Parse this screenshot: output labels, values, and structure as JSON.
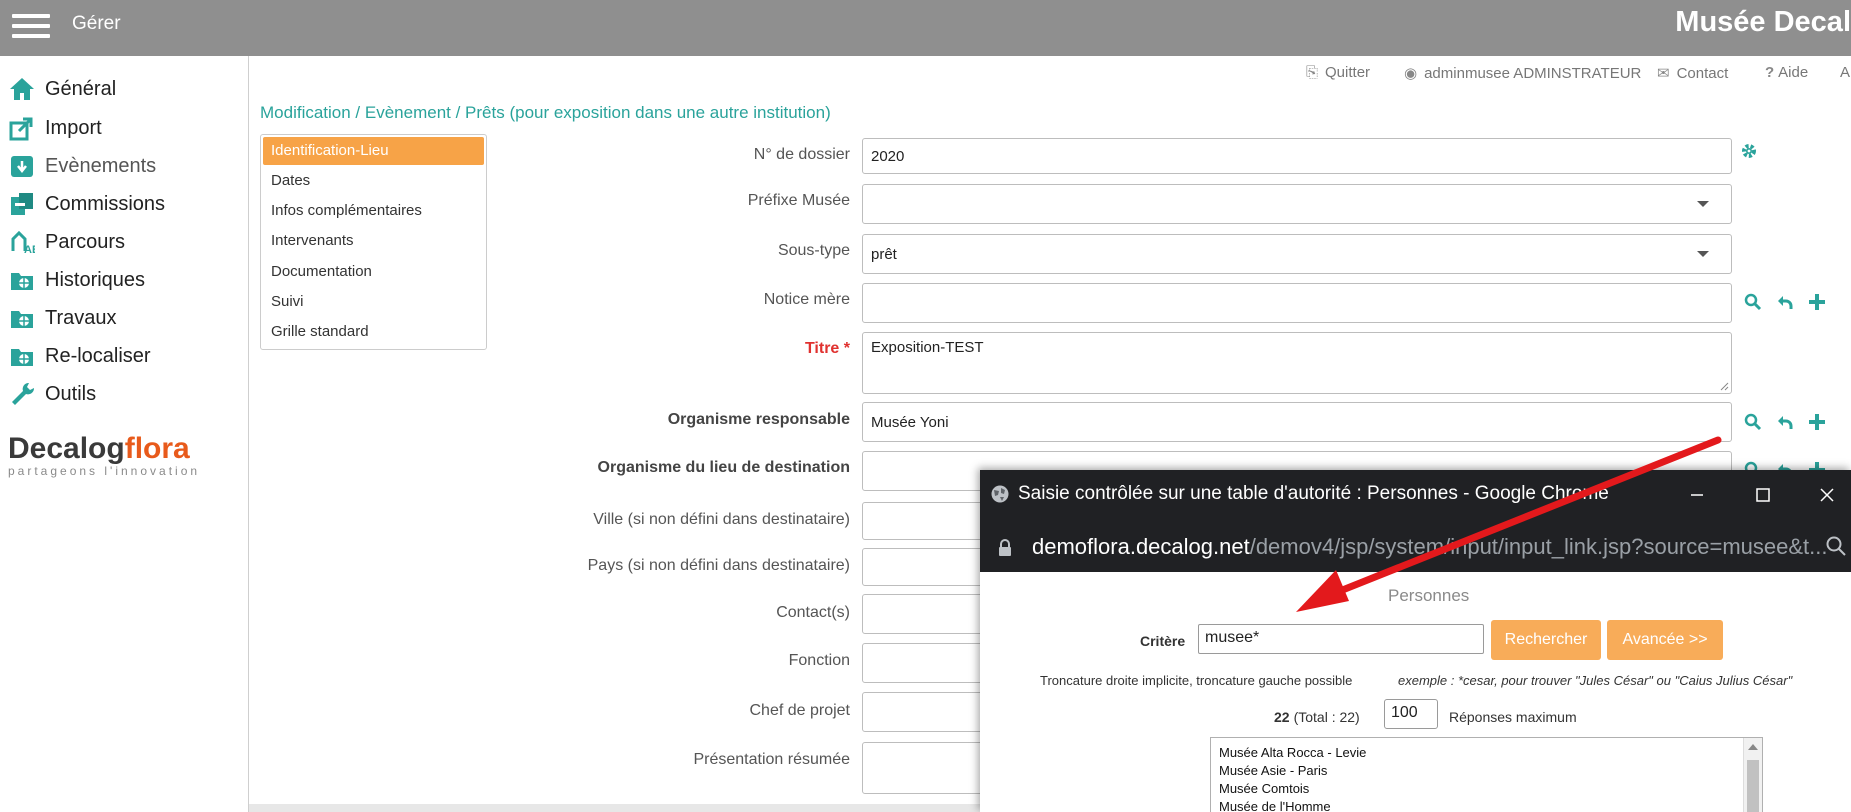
{
  "topbar": {
    "menu_label": "Gérer",
    "brand": "Musée Decal"
  },
  "sidebar": {
    "items": [
      {
        "label": "Général",
        "icon": "home-icon"
      },
      {
        "label": "Import",
        "icon": "import-icon"
      },
      {
        "label": "Evènements",
        "icon": "events-icon"
      },
      {
        "label": "Commissions",
        "icon": "commissions-icon"
      },
      {
        "label": "Parcours",
        "icon": "parcours-icon"
      },
      {
        "label": "Historiques",
        "icon": "historiques-icon"
      },
      {
        "label": "Travaux",
        "icon": "travaux-icon"
      },
      {
        "label": "Re-localiser",
        "icon": "relocaliser-icon"
      },
      {
        "label": "Outils",
        "icon": "wrench-icon"
      }
    ],
    "logo": {
      "part1": "Decalog",
      "part2": "flora",
      "tagline": "partageons l'innovation"
    }
  },
  "header_links": {
    "quit": "Quitter",
    "user": "adminmusee ADMINSTRATEUR",
    "contact": "Contact",
    "help": "Aide",
    "extra": "A"
  },
  "breadcrumb": "Modification / Evènement / Prêts (pour exposition dans une autre institution)",
  "tabs": [
    "Identification-Lieu",
    "Dates",
    "Infos complémentaires",
    "Intervenants",
    "Documentation",
    "Suivi",
    "Grille standard"
  ],
  "form": {
    "dossier": {
      "label": "N° de dossier",
      "value": "2020"
    },
    "prefixe": {
      "label": "Préfixe Musée",
      "value": ""
    },
    "soustype": {
      "label": "Sous-type",
      "value": "prêt"
    },
    "notice": {
      "label": "Notice mère",
      "value": ""
    },
    "titre": {
      "label": "Titre *",
      "value": "Exposition-TEST"
    },
    "org_resp": {
      "label": "Organisme responsable",
      "value": "Musée Yoni"
    },
    "org_dest": {
      "label": "Organisme du lieu de destination",
      "value": ""
    },
    "ville": {
      "label": "Ville (si non défini dans destinataire)",
      "value": ""
    },
    "pays": {
      "label": "Pays (si non défini dans destinataire)",
      "value": ""
    },
    "contacts": {
      "label": "Contact(s)",
      "value": ""
    },
    "fonction": {
      "label": "Fonction",
      "value": ""
    },
    "chef": {
      "label": "Chef de projet",
      "value": ""
    },
    "presentation": {
      "label": "Présentation résumée",
      "value": ""
    }
  },
  "popup": {
    "window_title": "Saisie contrôlée sur une table d'autorité : Personnes - Google Chrome",
    "url_host": "demoflora.decalog.net",
    "url_path": "/demov4/jsp/system/input/input_link.jsp?source=musee&t...",
    "heading": "Personnes",
    "criteria_label": "Critère",
    "criteria_value": "musee*",
    "search_button": "Rechercher",
    "advanced_button": "Avancée >>",
    "help_text": "Troncature droite implicite, troncature gauche possible",
    "help_example": "exemple : *cesar, pour trouver \"Jules César\" ou \"Caius Julius César\"",
    "count": "22",
    "total": "(Total : 22)",
    "max_value": "100",
    "max_label": "Réponses maximum",
    "results": [
      "Musée Alta Rocca - Levie",
      "Musée Asie - Paris",
      "Musée Comtois",
      "Musée de l'Homme"
    ]
  },
  "colors": {
    "accent": "#2aa39b",
    "tab_active": "#f7a347",
    "button": "#f8ac59",
    "required": "#e0312f",
    "arrow": "#e3191c"
  }
}
